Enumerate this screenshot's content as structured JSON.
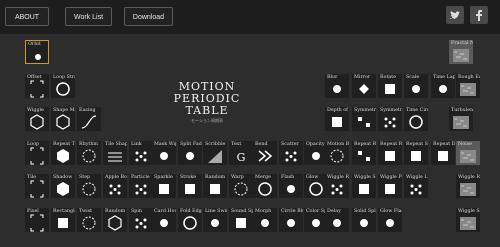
{
  "nav": {
    "about": "ABOUT",
    "work_list": "Work List",
    "download": "Download"
  },
  "social": [
    "twitter-icon",
    "facebook-icon"
  ],
  "title": {
    "line1": "MOTION",
    "line2": "PERIODIC TABLE",
    "sub": "モーション周期表"
  },
  "rows": [
    {
      "y": 0,
      "tiles": [
        [
          "Orbit",
          "dot-orbit",
          "gold"
        ],
        [
          "Fractal Noise",
          "noise",
          "gray"
        ]
      ]
    },
    {
      "y": 1,
      "tiles": [
        [
          "Offset",
          "corner",
          ""
        ],
        [
          "Loop Straight",
          "circle",
          ""
        ],
        [
          "Blur",
          "dot",
          ""
        ],
        [
          "Mirror",
          "diamond",
          ""
        ],
        [
          "Rotate",
          "sq",
          ""
        ],
        [
          "Scale",
          "dot",
          ""
        ],
        [
          "Time Lapse",
          "dot",
          ""
        ],
        [
          "Rough Edge",
          "noise",
          ""
        ]
      ]
    },
    {
      "y": 2,
      "tiles": [
        [
          "Wiggle",
          "hexo",
          ""
        ],
        [
          "Shape Morph",
          "hexo",
          ""
        ],
        [
          "Easing",
          "curve",
          ""
        ],
        [
          "Depth of Field",
          "sq",
          ""
        ],
        [
          "Symmetric Scale",
          "sqs",
          ""
        ],
        [
          "Symmetric Rotate",
          "dots",
          ""
        ],
        [
          "Time Circle",
          "circle",
          ""
        ],
        [
          "Turbulent Displace",
          "noise",
          ""
        ]
      ]
    },
    {
      "y": 3,
      "tiles": [
        [
          "Loop",
          "corner",
          ""
        ],
        [
          "Repeat Transform",
          "hex",
          ""
        ],
        [
          "Rhythm",
          "ring",
          ""
        ],
        [
          "Tile Shape",
          "lines",
          ""
        ],
        [
          "Link",
          "dots",
          ""
        ],
        [
          "Mask Wipe",
          "dot",
          ""
        ],
        [
          "Split Fade",
          "dot",
          ""
        ],
        [
          "Scribble",
          "diag",
          ""
        ],
        [
          "Text",
          "G",
          ""
        ],
        [
          "Bend",
          "chev",
          ""
        ],
        [
          "Scatter",
          "dots",
          ""
        ],
        [
          "Opacity",
          "dot",
          ""
        ],
        [
          "Motion Blur",
          "ring",
          ""
        ],
        [
          "Repeat Random",
          "sqs",
          ""
        ],
        [
          "Repeat Rotate",
          "sq",
          ""
        ],
        [
          "Repeat Scale",
          "sq",
          ""
        ],
        [
          "Repeat Delay",
          "sq",
          ""
        ],
        [
          "Noise",
          "noise",
          "gray"
        ]
      ]
    },
    {
      "y": 4,
      "tiles": [
        [
          "Tile",
          "corner",
          ""
        ],
        [
          "Shadow",
          "hex",
          ""
        ],
        [
          "Step",
          "ring",
          ""
        ],
        [
          "Apple Bounce",
          "dots",
          ""
        ],
        [
          "Particle",
          "dots",
          ""
        ],
        [
          "Sparkle",
          "sq",
          ""
        ],
        [
          "Stroke",
          "sq",
          ""
        ],
        [
          "Random",
          "sq",
          ""
        ],
        [
          "Warp",
          "ring",
          ""
        ],
        [
          "Merge",
          "circle",
          ""
        ],
        [
          "Flash",
          "dot",
          ""
        ],
        [
          "Glow",
          "circle",
          ""
        ],
        [
          "Wiggle Rotate",
          "dots",
          ""
        ],
        [
          "Wiggle Scale",
          "sq",
          ""
        ],
        [
          "Wiggle Position",
          "sq",
          ""
        ],
        [
          "Wiggle Line",
          "dots",
          ""
        ],
        [
          "Wiggle Rain",
          "noise",
          ""
        ]
      ]
    },
    {
      "y": 5,
      "tiles": [
        [
          "Pixel",
          "corner",
          ""
        ],
        [
          "Rectangle",
          "sq",
          ""
        ],
        [
          "Twist",
          "ring",
          ""
        ],
        [
          "Random Move",
          "hexo",
          ""
        ],
        [
          "Spin",
          "dots",
          ""
        ],
        [
          "Card House",
          "dot",
          ""
        ],
        [
          "Fold Edges",
          "circle",
          ""
        ],
        [
          "Line Swing",
          "dot",
          ""
        ],
        [
          "Sound Spread",
          "sq",
          ""
        ],
        [
          "Morph",
          "dot",
          ""
        ],
        [
          "Circle Blur",
          "dot",
          ""
        ],
        [
          "Color Splash",
          "dot",
          ""
        ],
        [
          "Delay",
          "dot",
          ""
        ],
        [
          "Solid Splash",
          "dot",
          ""
        ],
        [
          "Glow Flash",
          "dot",
          ""
        ],
        [
          "Wiggle Spin",
          "noise",
          ""
        ]
      ]
    }
  ]
}
